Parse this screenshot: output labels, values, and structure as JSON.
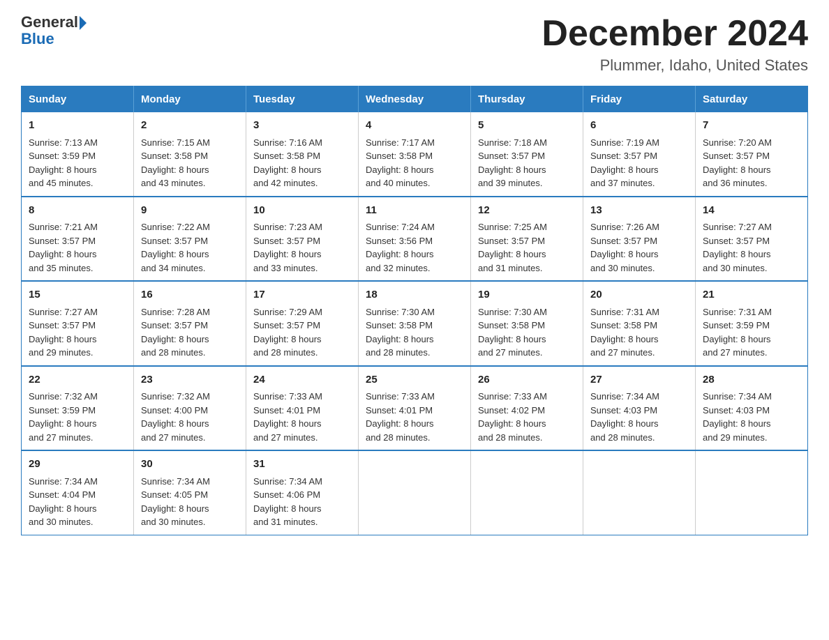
{
  "header": {
    "logo_general": "General",
    "logo_blue": "Blue",
    "title": "December 2024",
    "location": "Plummer, Idaho, United States"
  },
  "days_of_week": [
    "Sunday",
    "Monday",
    "Tuesday",
    "Wednesday",
    "Thursday",
    "Friday",
    "Saturday"
  ],
  "weeks": [
    [
      {
        "day": "1",
        "sunrise": "7:13 AM",
        "sunset": "3:59 PM",
        "daylight": "8 hours and 45 minutes."
      },
      {
        "day": "2",
        "sunrise": "7:15 AM",
        "sunset": "3:58 PM",
        "daylight": "8 hours and 43 minutes."
      },
      {
        "day": "3",
        "sunrise": "7:16 AM",
        "sunset": "3:58 PM",
        "daylight": "8 hours and 42 minutes."
      },
      {
        "day": "4",
        "sunrise": "7:17 AM",
        "sunset": "3:58 PM",
        "daylight": "8 hours and 40 minutes."
      },
      {
        "day": "5",
        "sunrise": "7:18 AM",
        "sunset": "3:57 PM",
        "daylight": "8 hours and 39 minutes."
      },
      {
        "day": "6",
        "sunrise": "7:19 AM",
        "sunset": "3:57 PM",
        "daylight": "8 hours and 37 minutes."
      },
      {
        "day": "7",
        "sunrise": "7:20 AM",
        "sunset": "3:57 PM",
        "daylight": "8 hours and 36 minutes."
      }
    ],
    [
      {
        "day": "8",
        "sunrise": "7:21 AM",
        "sunset": "3:57 PM",
        "daylight": "8 hours and 35 minutes."
      },
      {
        "day": "9",
        "sunrise": "7:22 AM",
        "sunset": "3:57 PM",
        "daylight": "8 hours and 34 minutes."
      },
      {
        "day": "10",
        "sunrise": "7:23 AM",
        "sunset": "3:57 PM",
        "daylight": "8 hours and 33 minutes."
      },
      {
        "day": "11",
        "sunrise": "7:24 AM",
        "sunset": "3:56 PM",
        "daylight": "8 hours and 32 minutes."
      },
      {
        "day": "12",
        "sunrise": "7:25 AM",
        "sunset": "3:57 PM",
        "daylight": "8 hours and 31 minutes."
      },
      {
        "day": "13",
        "sunrise": "7:26 AM",
        "sunset": "3:57 PM",
        "daylight": "8 hours and 30 minutes."
      },
      {
        "day": "14",
        "sunrise": "7:27 AM",
        "sunset": "3:57 PM",
        "daylight": "8 hours and 30 minutes."
      }
    ],
    [
      {
        "day": "15",
        "sunrise": "7:27 AM",
        "sunset": "3:57 PM",
        "daylight": "8 hours and 29 minutes."
      },
      {
        "day": "16",
        "sunrise": "7:28 AM",
        "sunset": "3:57 PM",
        "daylight": "8 hours and 28 minutes."
      },
      {
        "day": "17",
        "sunrise": "7:29 AM",
        "sunset": "3:57 PM",
        "daylight": "8 hours and 28 minutes."
      },
      {
        "day": "18",
        "sunrise": "7:30 AM",
        "sunset": "3:58 PM",
        "daylight": "8 hours and 28 minutes."
      },
      {
        "day": "19",
        "sunrise": "7:30 AM",
        "sunset": "3:58 PM",
        "daylight": "8 hours and 27 minutes."
      },
      {
        "day": "20",
        "sunrise": "7:31 AM",
        "sunset": "3:58 PM",
        "daylight": "8 hours and 27 minutes."
      },
      {
        "day": "21",
        "sunrise": "7:31 AM",
        "sunset": "3:59 PM",
        "daylight": "8 hours and 27 minutes."
      }
    ],
    [
      {
        "day": "22",
        "sunrise": "7:32 AM",
        "sunset": "3:59 PM",
        "daylight": "8 hours and 27 minutes."
      },
      {
        "day": "23",
        "sunrise": "7:32 AM",
        "sunset": "4:00 PM",
        "daylight": "8 hours and 27 minutes."
      },
      {
        "day": "24",
        "sunrise": "7:33 AM",
        "sunset": "4:01 PM",
        "daylight": "8 hours and 27 minutes."
      },
      {
        "day": "25",
        "sunrise": "7:33 AM",
        "sunset": "4:01 PM",
        "daylight": "8 hours and 28 minutes."
      },
      {
        "day": "26",
        "sunrise": "7:33 AM",
        "sunset": "4:02 PM",
        "daylight": "8 hours and 28 minutes."
      },
      {
        "day": "27",
        "sunrise": "7:34 AM",
        "sunset": "4:03 PM",
        "daylight": "8 hours and 28 minutes."
      },
      {
        "day": "28",
        "sunrise": "7:34 AM",
        "sunset": "4:03 PM",
        "daylight": "8 hours and 29 minutes."
      }
    ],
    [
      {
        "day": "29",
        "sunrise": "7:34 AM",
        "sunset": "4:04 PM",
        "daylight": "8 hours and 30 minutes."
      },
      {
        "day": "30",
        "sunrise": "7:34 AM",
        "sunset": "4:05 PM",
        "daylight": "8 hours and 30 minutes."
      },
      {
        "day": "31",
        "sunrise": "7:34 AM",
        "sunset": "4:06 PM",
        "daylight": "8 hours and 31 minutes."
      },
      null,
      null,
      null,
      null
    ]
  ],
  "labels": {
    "sunrise": "Sunrise:",
    "sunset": "Sunset:",
    "daylight": "Daylight:"
  }
}
